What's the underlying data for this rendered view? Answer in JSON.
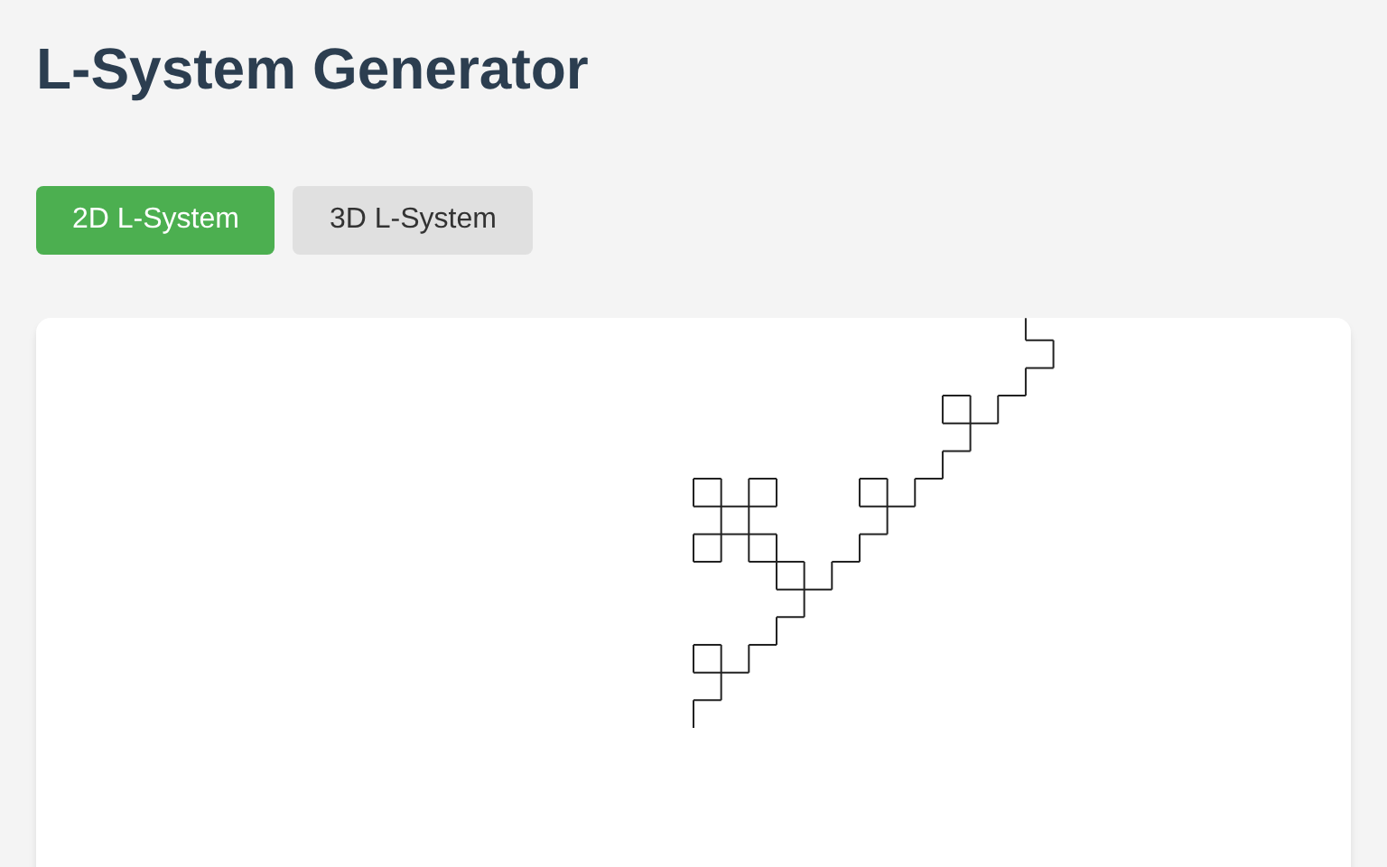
{
  "title": "L-System Generator",
  "tabs": [
    {
      "label": "2D L-System",
      "selected": true
    },
    {
      "label": "3D L-System",
      "selected": false
    }
  ]
}
